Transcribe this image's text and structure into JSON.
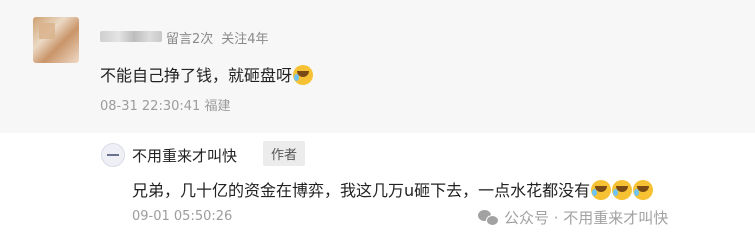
{
  "comment": {
    "meta_left": "留言2次",
    "meta_right": "关注4年",
    "text": "不能自己挣了钱，就砸盘呀",
    "time": "08-31 22:30:41",
    "location": "福建",
    "emoji_icon": "laughing-crying-emoji"
  },
  "reply": {
    "author": "不用重来才叫快",
    "badge": "作者",
    "text": "兄弟，几十亿的资金在博弈，我这几万u砸下去，一点水花都没有",
    "time": "09-01 05:50:26",
    "emoji_icon": "laughing-crying-emoji"
  },
  "watermark": {
    "text": "公众号 · 不用重来才叫快"
  }
}
